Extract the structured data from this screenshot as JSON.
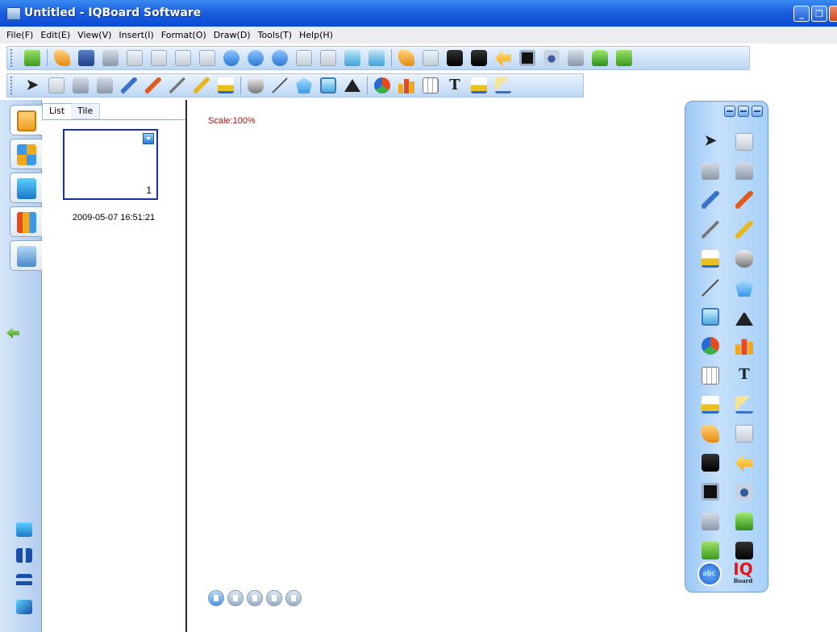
{
  "window": {
    "title": "Untitled - IQBoard Software",
    "buttons": {
      "minimize": "_",
      "restore": "❐",
      "close": "✕"
    }
  },
  "menu": [
    "File(F)",
    "Edit(E)",
    "View(V)",
    "Insert(I)",
    "Format(O)",
    "Draw(D)",
    "Tools(T)",
    "Help(H)"
  ],
  "toolbar_icons": {
    "row1": [
      "new-page",
      "open",
      "save",
      "save-as",
      "close-file",
      "copy",
      "cut",
      "paste",
      "zoom-in",
      "zoom-out",
      "zoom-menu",
      "fit",
      "hand",
      "page-size",
      "fullscreen",
      "screen-capture",
      "spotlight",
      "mask",
      "screen-annotate",
      "arrow-back",
      "blackboard",
      "camera",
      "recorder",
      "bag",
      "tools-extra"
    ],
    "row2": [
      "select",
      "mouse",
      "undo",
      "redo",
      "pen",
      "brush",
      "pencil",
      "highlighter",
      "eraser-brush",
      "eraser",
      "line",
      "pentagon",
      "chart",
      "triangle",
      "pie",
      "bar-chart",
      "table",
      "text",
      "fill",
      "ruler"
    ]
  },
  "panel": {
    "tabs": {
      "list": "List",
      "tile": "Tile"
    },
    "pages": [
      {
        "number": "1",
        "date": "2009-05-07 16:51:21"
      }
    ]
  },
  "canvas": {
    "scale": "Scale:100%"
  },
  "palette": {
    "text_tool": "abc",
    "logo": "IQ",
    "logo_sub": "Board"
  },
  "colors": {
    "titlebar": "#0b4bd4",
    "menu_bg": "#ecedf0",
    "scale_text": "#b01010",
    "palette_bg": "#c5e0fb",
    "thumb_border": "#1c2f9a"
  }
}
